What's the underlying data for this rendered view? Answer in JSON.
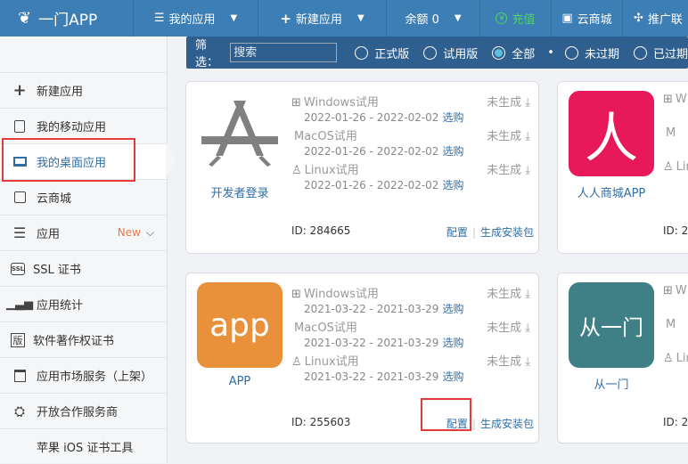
{
  "topbar": {
    "brand": "一门APP",
    "nav": [
      {
        "label": "我的应用",
        "icon": "menu-icon",
        "caret": true
      },
      {
        "label": "新建应用",
        "icon": "plus-icon",
        "caret": true
      },
      {
        "label": "余额 0",
        "icon": "",
        "caret": true
      },
      {
        "label": "充值",
        "icon": "currency-icon",
        "caret": false
      },
      {
        "label": "云商城",
        "icon": "shop-icon",
        "caret": false
      },
      {
        "label": "推广联",
        "icon": "share-icon",
        "caret": false
      }
    ],
    "accent_color": "#3d7eb4",
    "recharge_color": "#4fd26a"
  },
  "sidebar": {
    "items": [
      {
        "label": "新建应用",
        "icon": "plus-icon"
      },
      {
        "label": "我的移动应用",
        "icon": "tablet-icon"
      },
      {
        "label": "我的桌面应用",
        "icon": "monitor-icon",
        "active": true
      },
      {
        "label": "云商城",
        "icon": "shop-bag-icon"
      },
      {
        "label": "应用",
        "icon": "list-icon",
        "badge": "New"
      },
      {
        "label": "SSL 证书",
        "icon": "ssl-icon"
      },
      {
        "label": "应用统计",
        "icon": "bar-chart-icon"
      },
      {
        "label": "软件著作权证书",
        "icon": "certificate-icon"
      },
      {
        "label": "应用市场服务（上架）",
        "icon": "market-icon"
      },
      {
        "label": "开放合作服务商",
        "icon": "partner-icon"
      },
      {
        "label": "苹果 iOS 证书工具",
        "icon": "apple-icon"
      }
    ]
  },
  "filter": {
    "label": "筛选：",
    "search_placeholder": "搜索",
    "options": [
      "正式版",
      "试用版",
      "全部",
      "未过期",
      "已过期"
    ],
    "selected": "全部"
  },
  "cards": [
    {
      "name": "开发者登录",
      "logo_text": "",
      "logo_color": "#ffffff",
      "id_text": "ID: 284665",
      "platforms": [
        {
          "name": "Windows试用",
          "icon": "windows-icon",
          "status": "未生成",
          "date": "2022-01-26 - 2022-02-02",
          "action": "选购"
        },
        {
          "name": "MacOS试用",
          "icon": "apple-icon",
          "status": "未生成",
          "date": "2022-01-26 - 2022-02-02",
          "action": "选购"
        },
        {
          "name": "Linux试用",
          "icon": "linux-icon",
          "status": "未生成",
          "date": "2022-01-26 - 2022-02-02",
          "action": "选购"
        }
      ],
      "config": "配置",
      "build": "生成安装包"
    },
    {
      "name": "人人商城APP",
      "logo_text": "人",
      "logo_color": "#e8195a",
      "id_text": "ID: 2",
      "platforms": [
        {
          "name": "W",
          "icon": "windows-icon",
          "status": "",
          "date": "",
          "action": ""
        },
        {
          "name": "M",
          "icon": "apple-icon",
          "status": "",
          "date": "",
          "action": ""
        },
        {
          "name": "Lin",
          "icon": "linux-icon",
          "status": "",
          "date": "",
          "action": ""
        }
      ],
      "config": "",
      "build": ""
    },
    {
      "name": "APP",
      "logo_text": "app",
      "logo_color": "#e8913a",
      "id_text": "ID: 255603",
      "platforms": [
        {
          "name": "Windows试用",
          "icon": "windows-icon",
          "status": "未生成",
          "date": "2021-03-22 - 2021-03-29",
          "action": "选购"
        },
        {
          "name": "MacOS试用",
          "icon": "apple-icon",
          "status": "未生成",
          "date": "2021-03-22 - 2021-03-29",
          "action": "选购"
        },
        {
          "name": "Linux试用",
          "icon": "linux-icon",
          "status": "未生成",
          "date": "2021-03-22 - 2021-03-29",
          "action": "选购"
        }
      ],
      "config": "配置",
      "build": "生成安装包"
    },
    {
      "name": "从一门",
      "logo_text": "从一门",
      "logo_color": "#3f7f86",
      "id_text": "ID: 2",
      "platforms": [
        {
          "name": "W",
          "icon": "windows-icon",
          "status": "",
          "date": "",
          "action": ""
        },
        {
          "name": "M",
          "icon": "apple-icon",
          "status": "",
          "date": "",
          "action": ""
        },
        {
          "name": "Lin",
          "icon": "linux-icon",
          "status": "",
          "date": "",
          "action": ""
        }
      ],
      "config": "",
      "build": ""
    }
  ]
}
